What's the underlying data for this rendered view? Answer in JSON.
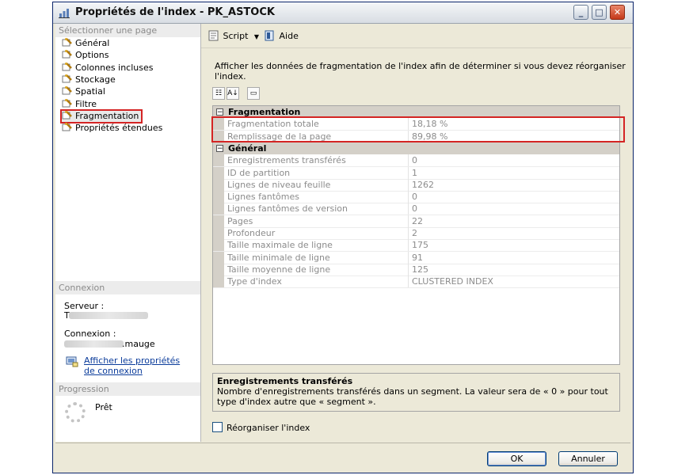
{
  "window": {
    "title": "Propriétés de l'index - PK_ASTOCK"
  },
  "left_pane": {
    "select_page_header": "Sélectionner une page",
    "pages": [
      {
        "label": "Général"
      },
      {
        "label": "Options"
      },
      {
        "label": "Colonnes incluses"
      },
      {
        "label": "Stockage"
      },
      {
        "label": "Spatial"
      },
      {
        "label": "Filtre"
      },
      {
        "label": "Fragmentation",
        "selected": true
      },
      {
        "label": "Propriétés étendues"
      }
    ],
    "connection_header": "Connexion",
    "server_label": "Serveur :",
    "server_value": "T",
    "connection_label": "Connexion :",
    "connection_value": ".mauge",
    "view_props_link": "Afficher les propriétés de connexion",
    "progress_header": "Progression",
    "progress_status": "Prêt"
  },
  "toolbar": {
    "script_label": "Script",
    "help_label": "Aide"
  },
  "description": "Afficher les données de fragmentation de l'index afin de déterminer si vous devez réorganiser l'index.",
  "grid": {
    "categories": [
      {
        "name": "Fragmentation",
        "rows": [
          {
            "name": "Fragmentation totale",
            "value": "18,18 %"
          },
          {
            "name": "Remplissage de la page",
            "value": "89,98 %"
          }
        ]
      },
      {
        "name": "Général",
        "rows": [
          {
            "name": "Enregistrements transférés",
            "value": "0"
          },
          {
            "name": "ID de partition",
            "value": "1"
          },
          {
            "name": "Lignes de niveau feuille",
            "value": "1262"
          },
          {
            "name": "Lignes fantômes",
            "value": "0"
          },
          {
            "name": "Lignes fantômes de version",
            "value": "0"
          },
          {
            "name": "Pages",
            "value": "22"
          },
          {
            "name": "Profondeur",
            "value": "2"
          },
          {
            "name": "Taille maximale de ligne",
            "value": "175"
          },
          {
            "name": "Taille minimale de ligne",
            "value": "91"
          },
          {
            "name": "Taille moyenne de ligne",
            "value": "125"
          },
          {
            "name": "Type d'index",
            "value": "CLUSTERED INDEX"
          }
        ]
      }
    ]
  },
  "help_panel": {
    "title": "Enregistrements transférés",
    "text": "Nombre d'enregistrements transférés dans un segment. La valeur sera de « 0 » pour tout type d'index autre que « segment »."
  },
  "reorganize_checkbox": {
    "label": "Réorganiser l'index",
    "checked": false
  },
  "footer": {
    "ok_label": "OK",
    "cancel_label": "Annuler"
  },
  "colors": {
    "highlight": "#d42424",
    "link": "#0b3c9b",
    "dialog_bg": "#ece9d8"
  }
}
